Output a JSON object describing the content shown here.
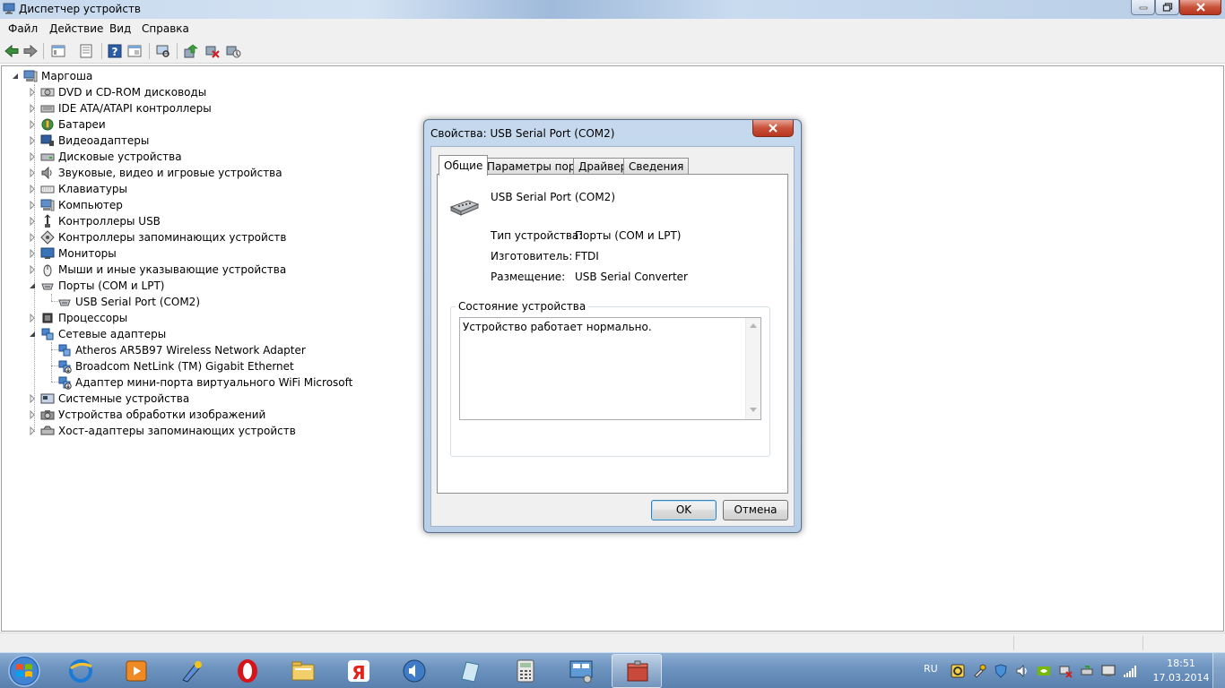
{
  "window": {
    "title": "Диспетчер устройств",
    "menu": [
      "Файл",
      "Действие",
      "Вид",
      "Справка"
    ]
  },
  "toolbar": {
    "buttons": [
      "back-icon",
      "forward-icon",
      "show-hide-tree-icon",
      "properties-icon",
      "console-icon",
      "help-icon",
      "view-icon",
      "scan-hardware-icon",
      "update-driver-icon",
      "disable-device-icon",
      "uninstall-device-icon"
    ]
  },
  "tree": {
    "root": "Маргоша",
    "items": [
      {
        "label": "DVD и CD-ROM дисководы",
        "icon": "dvd-drive-icon",
        "level": 1,
        "expanded": false
      },
      {
        "label": "IDE ATA/ATAPI контроллеры",
        "icon": "ide-controller-icon",
        "level": 1,
        "expanded": false
      },
      {
        "label": "Батареи",
        "icon": "battery-icon",
        "level": 1,
        "expanded": false
      },
      {
        "label": "Видеоадаптеры",
        "icon": "display-adapter-icon",
        "level": 1,
        "expanded": false
      },
      {
        "label": "Дисковые устройства",
        "icon": "disk-drive-icon",
        "level": 1,
        "expanded": false
      },
      {
        "label": "Звуковые, видео и игровые устройства",
        "icon": "sound-device-icon",
        "level": 1,
        "expanded": false
      },
      {
        "label": "Клавиатуры",
        "icon": "keyboard-icon",
        "level": 1,
        "expanded": false
      },
      {
        "label": "Компьютер",
        "icon": "computer-icon",
        "level": 1,
        "expanded": false
      },
      {
        "label": "Контроллеры USB",
        "icon": "usb-controller-icon",
        "level": 1,
        "expanded": false
      },
      {
        "label": "Контроллеры запоминающих устройств",
        "icon": "storage-controller-icon",
        "level": 1,
        "expanded": false
      },
      {
        "label": "Мониторы",
        "icon": "monitor-icon",
        "level": 1,
        "expanded": false
      },
      {
        "label": "Мыши и иные указывающие устройства",
        "icon": "mouse-icon",
        "level": 1,
        "expanded": false
      },
      {
        "label": "Порты (COM и LPT)",
        "icon": "port-icon",
        "level": 1,
        "expanded": true
      },
      {
        "label": "USB Serial Port (COM2)",
        "icon": "port-icon",
        "level": 2
      },
      {
        "label": "Процессоры",
        "icon": "processor-icon",
        "level": 1,
        "expanded": false
      },
      {
        "label": "Сетевые адаптеры",
        "icon": "network-adapter-icon",
        "level": 1,
        "expanded": true
      },
      {
        "label": "Atheros AR5B97 Wireless Network Adapter",
        "icon": "network-adapter-icon",
        "level": 2
      },
      {
        "label": "Broadcom NetLink (TM) Gigabit Ethernet",
        "icon": "network-adapter-disabled-icon",
        "level": 2
      },
      {
        "label": "Адаптер мини-порта виртуального WiFi Microsoft",
        "icon": "network-adapter-disabled-icon",
        "level": 2
      },
      {
        "label": "Системные устройства",
        "icon": "system-device-icon",
        "level": 1,
        "expanded": false
      },
      {
        "label": "Устройства обработки изображений",
        "icon": "imaging-device-icon",
        "level": 1,
        "expanded": false
      },
      {
        "label": "Хост-адаптеры запоминающих устройств",
        "icon": "storage-host-icon",
        "level": 1,
        "expanded": false
      }
    ]
  },
  "dialog": {
    "title": "Свойства: USB Serial Port (COM2)",
    "tabs": [
      "Общие",
      "Параметры порта",
      "Драйвер",
      "Сведения"
    ],
    "active_tab": 0,
    "device_name": "USB Serial Port (COM2)",
    "properties": [
      {
        "label": "Тип устройства:",
        "value": "Порты (COM и LPT)"
      },
      {
        "label": "Изготовитель:",
        "value": "FTDI"
      },
      {
        "label": "Размещение:",
        "value": "USB Serial Converter"
      }
    ],
    "status_group_label": "Состояние устройства",
    "status_text": "Устройство работает нормально.",
    "ok_label": "OK",
    "cancel_label": "Отмена"
  },
  "taskbar": {
    "apps": [
      "internet-explorer-icon",
      "media-player-icon",
      "paint-icon",
      "opera-icon",
      "file-explorer-icon",
      "yandex-icon",
      "volume-app-icon",
      "notes-icon",
      "calculator-icon",
      "control-panel-icon",
      "device-manager-icon"
    ],
    "active_app": 10,
    "language": "RU",
    "time": "18:51",
    "date": "17.03.2014"
  },
  "colors": {
    "title_bar": "#c7d9ee",
    "dialog_frame": "#b9cfe8",
    "taskbar": "#6e94c0",
    "close_button": "#c85239"
  }
}
